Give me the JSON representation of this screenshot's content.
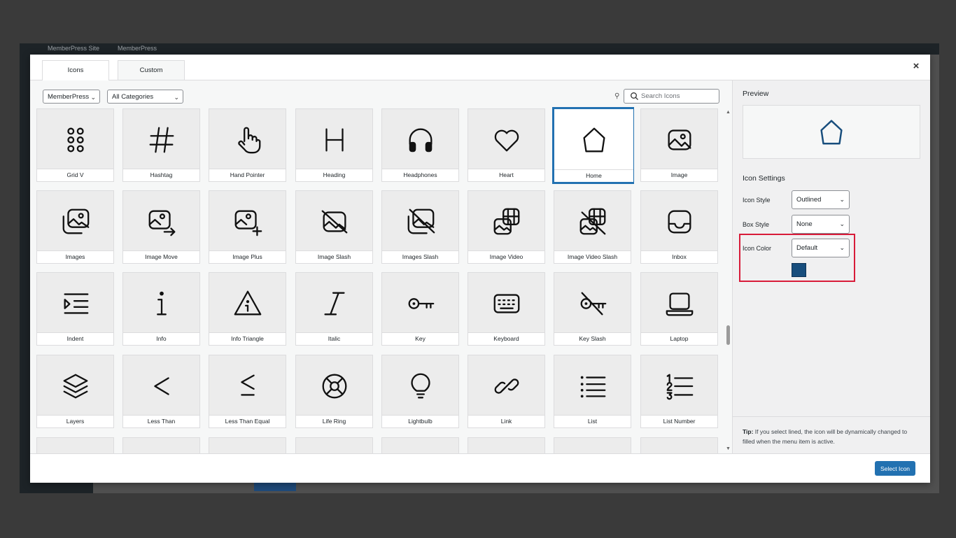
{
  "backdrop": {
    "adminbar": {
      "site_name": "MemberPress Site",
      "plugin_name": "MemberPress"
    }
  },
  "modal": {
    "tabs": [
      {
        "label": "Icons",
        "active": true
      },
      {
        "label": "Custom",
        "active": false
      }
    ],
    "close_label": "×",
    "filters": {
      "library": "MemberPress",
      "category": "All Categories",
      "search_placeholder": "Search Icons"
    },
    "icons": [
      {
        "label": "Grid V",
        "icon": "grid-v-icon"
      },
      {
        "label": "Hashtag",
        "icon": "hashtag-icon"
      },
      {
        "label": "Hand Pointer",
        "icon": "hand-pointer-icon"
      },
      {
        "label": "Heading",
        "icon": "heading-icon"
      },
      {
        "label": "Headphones",
        "icon": "headphones-icon"
      },
      {
        "label": "Heart",
        "icon": "heart-icon"
      },
      {
        "label": "Home",
        "icon": "home-icon",
        "selected": true
      },
      {
        "label": "Image",
        "icon": "image-icon"
      },
      {
        "label": "Images",
        "icon": "images-icon"
      },
      {
        "label": "Image Move",
        "icon": "image-move-icon"
      },
      {
        "label": "Image Plus",
        "icon": "image-plus-icon"
      },
      {
        "label": "Image Slash",
        "icon": "image-slash-icon"
      },
      {
        "label": "Images Slash",
        "icon": "images-slash-icon"
      },
      {
        "label": "Image Video",
        "icon": "image-video-icon"
      },
      {
        "label": "Image Video Slash",
        "icon": "image-video-slash-icon"
      },
      {
        "label": "Inbox",
        "icon": "inbox-icon"
      },
      {
        "label": "Indent",
        "icon": "indent-icon"
      },
      {
        "label": "Info",
        "icon": "info-icon"
      },
      {
        "label": "Info Triangle",
        "icon": "info-triangle-icon"
      },
      {
        "label": "Italic",
        "icon": "italic-icon"
      },
      {
        "label": "Key",
        "icon": "key-icon"
      },
      {
        "label": "Keyboard",
        "icon": "keyboard-icon"
      },
      {
        "label": "Key Slash",
        "icon": "key-slash-icon"
      },
      {
        "label": "Laptop",
        "icon": "laptop-icon"
      },
      {
        "label": "Layers",
        "icon": "layers-icon"
      },
      {
        "label": "Less Than",
        "icon": "less-than-icon"
      },
      {
        "label": "Less Than Equal",
        "icon": "less-than-equal-icon"
      },
      {
        "label": "Life Ring",
        "icon": "life-ring-icon"
      },
      {
        "label": "Lightbulb",
        "icon": "lightbulb-icon"
      },
      {
        "label": "Link",
        "icon": "link-icon"
      },
      {
        "label": "List",
        "icon": "list-icon"
      },
      {
        "label": "List Number",
        "icon": "list-number-icon"
      }
    ],
    "preview": {
      "heading": "Preview",
      "icon": "home-icon",
      "color": "#184e7d"
    },
    "settings": {
      "heading": "Icon Settings",
      "icon_style": {
        "label": "Icon Style",
        "value": "Outlined"
      },
      "box_style": {
        "label": "Box Style",
        "value": "None"
      },
      "icon_color": {
        "label": "Icon Color",
        "value": "Default",
        "swatch": "#184e7d"
      }
    },
    "tip": {
      "prefix": "Tip:",
      "text": " If you select lined, the icon will be dynamically changed to filled when the menu item is active."
    },
    "footer": {
      "select_button": "Select Icon"
    }
  },
  "colors": {
    "accent": "#2271b1",
    "highlight": "#d81b39"
  }
}
